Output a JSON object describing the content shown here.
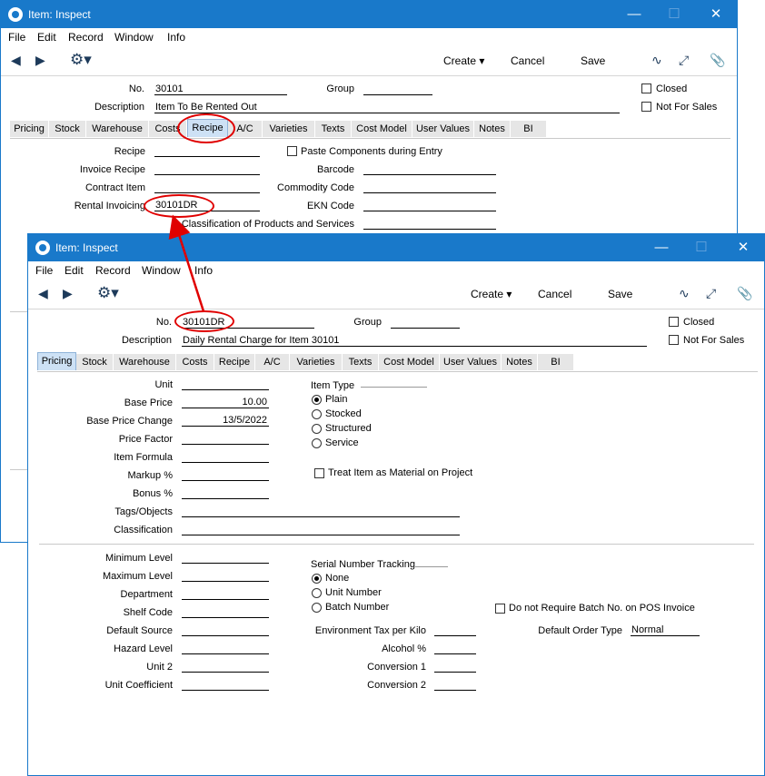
{
  "win1": {
    "title": "Item: Inspect",
    "menu": [
      "File",
      "Edit",
      "Record",
      "Window",
      "Info"
    ],
    "toolbar": {
      "create": "Create",
      "cancel": "Cancel",
      "save": "Save"
    },
    "header": {
      "no_label": "No.",
      "no_value": "30101",
      "group_label": "Group",
      "group_value": "",
      "desc_label": "Description",
      "desc_value": "Item To Be Rented Out",
      "closed": "Closed",
      "not_for_sales": "Not For Sales"
    },
    "tabs": [
      "Pricing",
      "Stock",
      "Warehouse",
      "Costs",
      "Recipe",
      "A/C",
      "Varieties",
      "Texts",
      "Cost Model",
      "User Values",
      "Notes",
      "BI"
    ],
    "active_tab": "Recipe",
    "recipe": {
      "recipe_label": "Recipe",
      "invoice_recipe_label": "Invoice Recipe",
      "contract_item_label": "Contract Item",
      "rental_invoicing_label": "Rental Invoicing",
      "rental_invoicing_value": "30101DR",
      "paste_components": "Paste Components during Entry",
      "barcode_label": "Barcode",
      "commodity_code_label": "Commodity Code",
      "ekn_code_label": "EKN Code",
      "classification_label": "Classification of Products and Services"
    }
  },
  "win2": {
    "title": "Item: Inspect",
    "menu": [
      "File",
      "Edit",
      "Record",
      "Window",
      "Info"
    ],
    "toolbar": {
      "create": "Create",
      "cancel": "Cancel",
      "save": "Save"
    },
    "header": {
      "no_label": "No.",
      "no_value": "30101DR",
      "group_label": "Group",
      "group_value": "",
      "desc_label": "Description",
      "desc_value": "Daily Rental Charge for Item 30101",
      "closed": "Closed",
      "not_for_sales": "Not For Sales"
    },
    "tabs": [
      "Pricing",
      "Stock",
      "Warehouse",
      "Costs",
      "Recipe",
      "A/C",
      "Varieties",
      "Texts",
      "Cost Model",
      "User Values",
      "Notes",
      "BI"
    ],
    "active_tab": "Pricing",
    "pricing": {
      "unit_label": "Unit",
      "unit_value": "",
      "base_price_label": "Base Price",
      "base_price_value": "10.00",
      "base_price_change_label": "Base Price Change",
      "base_price_change_value": "13/5/2022",
      "price_factor_label": "Price Factor",
      "item_formula_label": "Item Formula",
      "markup_label": "Markup %",
      "bonus_label": "Bonus %",
      "tags_label": "Tags/Objects",
      "classification_label": "Classification",
      "item_type_label": "Item Type",
      "item_type_options": [
        "Plain",
        "Stocked",
        "Structured",
        "Service"
      ],
      "item_type_selected": "Plain",
      "treat_as_material": "Treat Item as Material on Project",
      "min_level_label": "Minimum Level",
      "max_level_label": "Maximum Level",
      "department_label": "Department",
      "shelf_code_label": "Shelf Code",
      "default_source_label": "Default Source",
      "hazard_level_label": "Hazard Level",
      "unit2_label": "Unit 2",
      "unit_coeff_label": "Unit Coefficient",
      "serial_tracking_label": "Serial Number Tracking",
      "serial_options": [
        "None",
        "Unit Number",
        "Batch Number"
      ],
      "serial_selected": "None",
      "env_tax_label": "Environment Tax per Kilo",
      "alcohol_label": "Alcohol %",
      "conv1_label": "Conversion 1",
      "conv2_label": "Conversion 2",
      "no_batch_pos": "Do not Require Batch No. on POS Invoice",
      "default_order_type_label": "Default Order Type",
      "default_order_type_value": "Normal"
    }
  }
}
